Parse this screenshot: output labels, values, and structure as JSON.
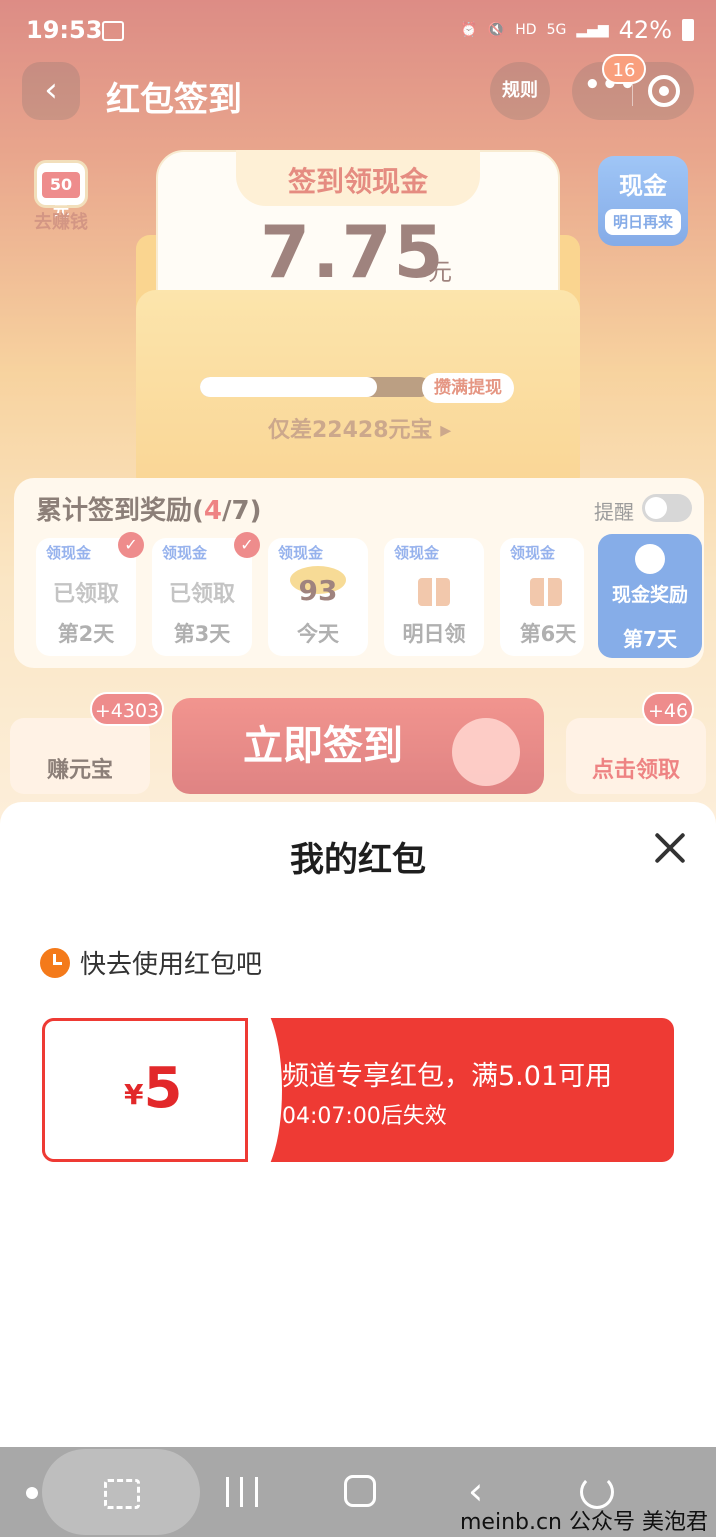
{
  "status_bar": {
    "time": "19:53",
    "network": "HD",
    "network2": "5G",
    "battery": "42%"
  },
  "header": {
    "title": "红包签到",
    "rules_label": "规则",
    "more_label": "•••",
    "notification_count": "16"
  },
  "earn_money": {
    "badge": "50元",
    "label": "去赚钱"
  },
  "cash_tile": {
    "title": "现金",
    "subtitle": "明日再来"
  },
  "card": {
    "title": "签到领现金",
    "amount": "7.75",
    "unit": "元",
    "progress_fraction": 0.77,
    "progress_tag": "攒满提现",
    "progress_text": "仅差22428元宝 ▸"
  },
  "rewards": {
    "title_prefix": "累计签到奖励(",
    "count": "4",
    "title_suffix": "/7)",
    "remind_label": "提醒",
    "days": [
      {
        "tag": "领现金",
        "status": "已领取",
        "day": "第2天"
      },
      {
        "tag": "领现金",
        "status": "已领取",
        "day": "第3天"
      },
      {
        "tag": "领现金",
        "status": "93",
        "day": "今天"
      },
      {
        "tag": "领现金",
        "status": "",
        "day": "明日领"
      },
      {
        "tag": "领现金",
        "status": "",
        "day": "第6天"
      }
    ],
    "day7": {
      "title": "现金奖励",
      "day": "第7天"
    }
  },
  "actions": {
    "left_label": "赚元宝",
    "left_badge": "+4303",
    "sign_label": "立即签到",
    "right_label": "点击领取",
    "right_badge": "+46"
  },
  "sheet": {
    "title": "我的红包",
    "hint": "快去使用红包吧",
    "coupon": {
      "currency": "¥",
      "amount": "5",
      "description": "频道专享红包，满5.01可用",
      "expiry": "04:07:00后失效"
    }
  },
  "watermark": "meinb.cn 公众号 美泡君"
}
